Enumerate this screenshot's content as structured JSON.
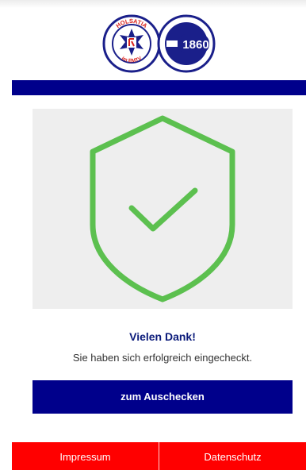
{
  "header": {
    "logo_left_text_top": "HOLSATIA",
    "logo_left_text_bottom": "im EMTV",
    "logo_right_text": "1860",
    "brand_color": "#00008b"
  },
  "main": {
    "status_icon": "shield-check-icon",
    "icon_color": "#5cc04f",
    "title": "Vielen Dank!",
    "subtitle": "Sie haben sich erfolgreich eingecheckt.",
    "checkout_button_label": "zum Auschecken"
  },
  "footer": {
    "accent_color": "#ff0000",
    "links": [
      {
        "label": "Impressum"
      },
      {
        "label": "Datenschutz"
      }
    ]
  }
}
